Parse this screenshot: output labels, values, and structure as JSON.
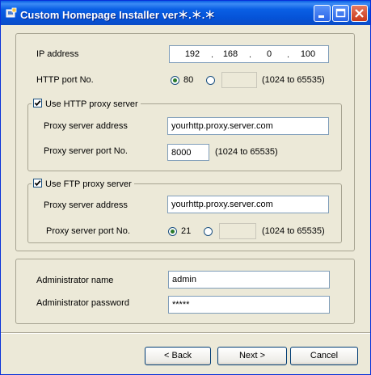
{
  "window": {
    "title": "Custom Homepage Installer",
    "version": "ver＊.＊.＊"
  },
  "ip": {
    "label": "IP address",
    "octets": [
      "192",
      "168",
      "0",
      "100"
    ],
    "dot": "."
  },
  "http_port": {
    "label": "HTTP port No.",
    "option_default": "80",
    "custom_value": "",
    "range_hint": "(1024 to 65535)",
    "selected": "default"
  },
  "http_proxy": {
    "legend": "Use HTTP proxy server",
    "checked": true,
    "address_label": "Proxy server address",
    "address_value": "yourhttp.proxy.server.com",
    "port_label": "Proxy server port No.",
    "port_value": "8000",
    "range_hint": "(1024 to 65535)"
  },
  "ftp_proxy": {
    "legend": "Use FTP proxy server",
    "checked": true,
    "address_label": "Proxy server address",
    "address_value": "yourhttp.proxy.server.com",
    "port_label": "Proxy server port No.",
    "option_default": "21",
    "custom_value": "",
    "range_hint": "(1024 to 65535)",
    "selected": "default"
  },
  "admin": {
    "name_label": "Administrator name",
    "name_value": "admin",
    "password_label": "Administrator password",
    "password_value": "*****"
  },
  "buttons": {
    "back": "< Back",
    "next": "Next >",
    "cancel": "Cancel"
  }
}
